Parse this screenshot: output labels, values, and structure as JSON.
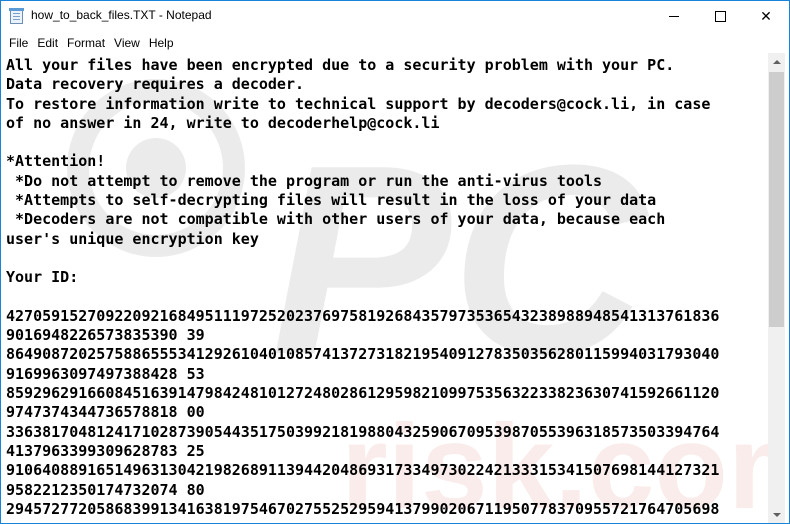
{
  "window": {
    "title": "how_to_back_files.TXT - Notepad",
    "accent_color": "#1883d7",
    "controls": {
      "minimize_icon": "minimize-icon",
      "maximize_icon": "maximize-icon",
      "close_icon": "close-icon",
      "close_glyph": "✕"
    }
  },
  "menu": [
    "File",
    "Edit",
    "Format",
    "View",
    "Help"
  ],
  "document": {
    "lines": [
      "All your files have been encrypted due to a security problem with your PC.",
      "Data recovery requires a decoder.",
      "To restore information write to technical support by decoders@cock.li, in case",
      "of no answer in 24, write to decoderhelp@cock.li",
      "",
      "*Attention!",
      " *Do not attempt to remove the program or run the anti-virus tools",
      " *Attempts to self-decrypting files will result in the loss of your data",
      " *Decoders are not compatible with other users of your data, because each",
      "user's unique encryption key",
      "",
      "Your ID:",
      "",
      "4270591527092209216849511197252023769758192684357973536543238988948541313761836",
      "9016948226573835390 39",
      "8649087202575886555341292610401085741372731821954091278350356280115994031793040",
      "9169963097497388428 53",
      "8592962916608451639147984248101272480286129598210997535632233823630741592661120",
      "9747374344736578818 00",
      "3363817048124171028739054435175039921819880432590670953987055396318573503394764",
      "4137963399309628783 25",
      "9106408891651496313042198268911394420486931733497302242133315341507698144127321",
      "9582212350174732074 80",
      "2945727720586839913416381975467027552529594137990206711950778370955721764705698"
    ]
  },
  "watermark_text": "PC risk.com"
}
